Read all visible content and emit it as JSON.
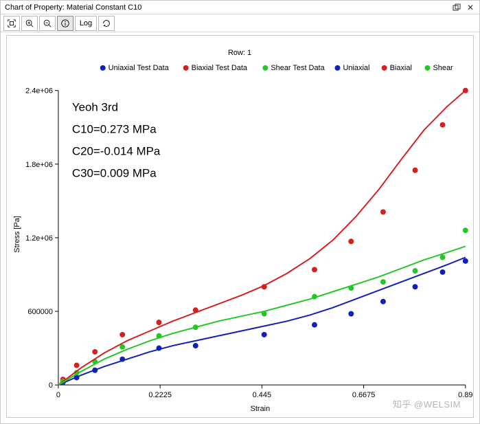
{
  "window": {
    "title": "Chart of Property: Material Constant C10"
  },
  "toolbar": {
    "log_label": "Log"
  },
  "chart": {
    "subtitle": "Row: 1",
    "ylabel": "Stress [Pa]",
    "xlabel": "Strain"
  },
  "legend": {
    "uniax_data": "Uniaxial Test Data",
    "biax_data": "Biaxial Test Data",
    "shear_data": "Shear Test Data",
    "uniax": "Uniaxial",
    "biax": "Biaxial",
    "shear": "Shear"
  },
  "annotation": {
    "line1": "Yeoh 3rd",
    "line2": "C10=0.273 MPa",
    "line3": "C20=-0.014 MPa",
    "line4": "C30=0.009 MPa"
  },
  "axes": {
    "xticks": [
      "0",
      "0.2225",
      "0.445",
      "0.6675",
      "0.89"
    ],
    "yticks": [
      "0",
      "600000",
      "1.2e+06",
      "1.8e+06",
      "2.4e+06"
    ]
  },
  "watermark": "知乎 @WELSIM",
  "colors": {
    "blue": "#1020b8",
    "red": "#d62020",
    "green": "#24c824",
    "axis": "#000",
    "grid": "#000"
  },
  "chart_data": {
    "type": "scatter+line",
    "title": "Row: 1",
    "xlabel": "Strain",
    "ylabel": "Stress [Pa]",
    "xlim": [
      0.0,
      0.89
    ],
    "ylim": [
      0.0,
      2400000
    ],
    "xticks": [
      0.0,
      0.2225,
      0.445,
      0.6675,
      0.89
    ],
    "yticks": [
      0,
      600000,
      1200000,
      1800000,
      2400000
    ],
    "annotations": [
      "Yeoh 3rd",
      "C10=0.273 MPa",
      "C20=-0.014 MPa",
      "C30=0.009 MPa"
    ],
    "legend": [
      "Uniaxial Test Data",
      "Biaxial Test Data",
      "Shear Test Data",
      "Uniaxial",
      "Biaxial",
      "Shear"
    ],
    "series": [
      {
        "name": "Uniaxial Test Data",
        "kind": "scatter",
        "color": "#1020b8",
        "x": [
          0.01,
          0.04,
          0.08,
          0.14,
          0.22,
          0.3,
          0.45,
          0.56,
          0.64,
          0.71,
          0.78,
          0.84,
          0.89
        ],
        "y": [
          20000,
          60000,
          120000,
          210000,
          300000,
          320000,
          410000,
          490000,
          580000,
          680000,
          800000,
          920000,
          1010000
        ]
      },
      {
        "name": "Biaxial Test Data",
        "kind": "scatter",
        "color": "#d62020",
        "x": [
          0.01,
          0.04,
          0.08,
          0.14,
          0.22,
          0.3,
          0.45,
          0.56,
          0.64,
          0.71,
          0.78,
          0.84,
          0.89
        ],
        "y": [
          45000,
          160000,
          270000,
          410000,
          510000,
          610000,
          800000,
          940000,
          1170000,
          1410000,
          1750000,
          2120000,
          2400000
        ]
      },
      {
        "name": "Shear Test Data",
        "kind": "scatter",
        "color": "#24c824",
        "x": [
          0.01,
          0.04,
          0.08,
          0.14,
          0.22,
          0.3,
          0.45,
          0.56,
          0.64,
          0.71,
          0.78,
          0.84,
          0.89
        ],
        "y": [
          30000,
          100000,
          190000,
          310000,
          400000,
          470000,
          580000,
          720000,
          790000,
          840000,
          930000,
          1040000,
          1260000
        ]
      },
      {
        "name": "Uniaxial",
        "kind": "line",
        "color": "#1020b8",
        "x": [
          0.0,
          0.05,
          0.1,
          0.15,
          0.2,
          0.25,
          0.3,
          0.35,
          0.4,
          0.45,
          0.5,
          0.55,
          0.6,
          0.65,
          0.7,
          0.75,
          0.8,
          0.85,
          0.89
        ],
        "y": [
          0,
          80000,
          150000,
          210000,
          270000,
          320000,
          360000,
          400000,
          440000,
          480000,
          520000,
          570000,
          630000,
          700000,
          770000,
          840000,
          910000,
          980000,
          1040000
        ]
      },
      {
        "name": "Biaxial",
        "kind": "line",
        "color": "#d62020",
        "x": [
          0.0,
          0.05,
          0.1,
          0.15,
          0.2,
          0.25,
          0.3,
          0.35,
          0.4,
          0.45,
          0.5,
          0.55,
          0.6,
          0.65,
          0.7,
          0.75,
          0.8,
          0.85,
          0.89
        ],
        "y": [
          0,
          140000,
          260000,
          360000,
          440000,
          520000,
          590000,
          660000,
          730000,
          810000,
          910000,
          1030000,
          1180000,
          1370000,
          1590000,
          1840000,
          2080000,
          2270000,
          2400000
        ]
      },
      {
        "name": "Shear",
        "kind": "line",
        "color": "#24c824",
        "x": [
          0.0,
          0.05,
          0.1,
          0.15,
          0.2,
          0.25,
          0.3,
          0.35,
          0.4,
          0.45,
          0.5,
          0.55,
          0.6,
          0.65,
          0.7,
          0.75,
          0.8,
          0.85,
          0.89
        ],
        "y": [
          0,
          110000,
          210000,
          290000,
          360000,
          420000,
          470000,
          520000,
          560000,
          600000,
          650000,
          700000,
          760000,
          820000,
          880000,
          950000,
          1020000,
          1080000,
          1130000
        ]
      }
    ]
  }
}
